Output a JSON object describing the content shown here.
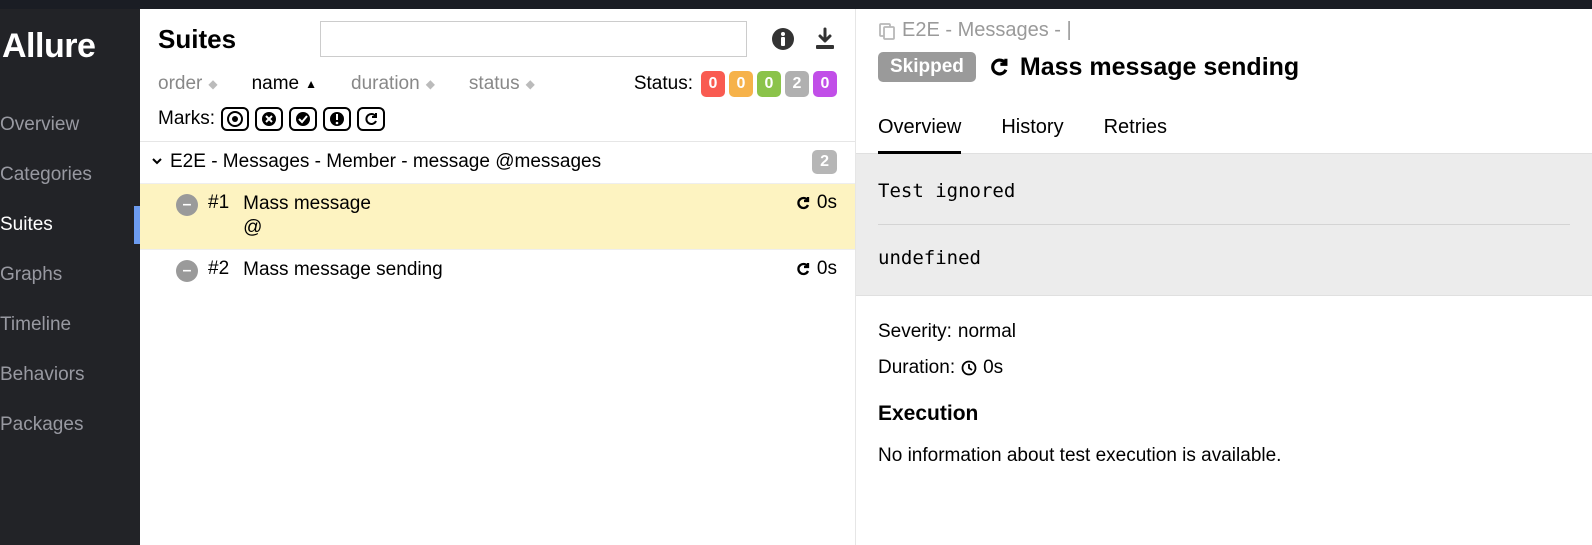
{
  "brand": "Allure",
  "nav": [
    {
      "label": "Overview",
      "active": false
    },
    {
      "label": "Categories",
      "active": false
    },
    {
      "label": "Suites",
      "active": true
    },
    {
      "label": "Graphs",
      "active": false
    },
    {
      "label": "Timeline",
      "active": false
    },
    {
      "label": "Behaviors",
      "active": false
    },
    {
      "label": "Packages",
      "active": false
    }
  ],
  "center": {
    "title": "Suites",
    "search_placeholder": "",
    "sort": {
      "order": "order",
      "name": "name",
      "duration": "duration",
      "status": "status"
    },
    "status_label": "Status:",
    "status_counts": {
      "failed": "0",
      "broken": "0",
      "passed": "0",
      "skipped": "2",
      "unknown": "0"
    },
    "marks_label": "Marks:",
    "group": {
      "name": "E2E - Messages - Member - message @messages",
      "count": "2"
    },
    "items": [
      {
        "num": "#1",
        "name_a": "Mass message",
        "name_b": "@",
        "duration": "0s",
        "selected": true
      },
      {
        "num": "#2",
        "name": "Mass message sending",
        "duration": "0s",
        "selected": false
      }
    ]
  },
  "right": {
    "breadcrumb": "E2E - Messages - |",
    "status": "Skipped",
    "title": "Mass message sending",
    "tabs": [
      "Overview",
      "History",
      "Retries"
    ],
    "message": "Test ignored",
    "trace": "undefined",
    "severity_label": "Severity:",
    "severity_value": "normal",
    "duration_label": "Duration:",
    "duration_value": "0s",
    "execution_head": "Execution",
    "execution_msg": "No information about test execution is available."
  }
}
